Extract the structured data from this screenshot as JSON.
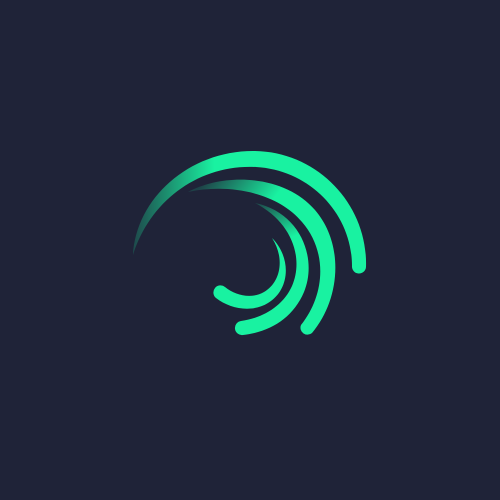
{
  "screen": {
    "background_color": "#1f2338"
  },
  "logo": {
    "icon": "swirl-spiral-icon",
    "arc_color": "#19f2a1",
    "arcs": [
      {
        "name": "outer-arc"
      },
      {
        "name": "middle-arc"
      },
      {
        "name": "inner-arc"
      }
    ]
  }
}
